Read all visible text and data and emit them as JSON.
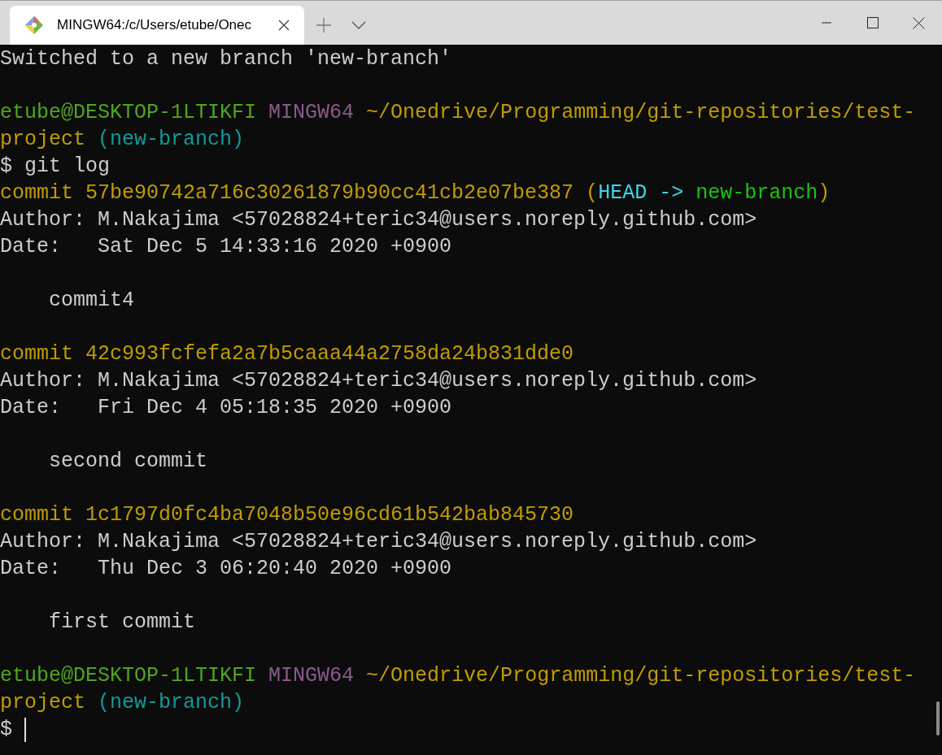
{
  "tab": {
    "title": "MINGW64:/c/Users/etube/Onec",
    "selected": true
  },
  "terminal": {
    "blocks": [
      [
        [
          {
            "text": "Switched to a new branch 'new-branch'",
            "kind": "plain"
          }
        ]
      ],
      [
        [
          {
            "text": "etube@DESKTOP-1LTIKFI ",
            "kind": "user"
          },
          {
            "text": "MINGW64 ",
            "kind": "system"
          },
          {
            "text": "~/Onedrive/Programming/git-repositories/test-",
            "kind": "path"
          }
        ],
        [
          {
            "text": "project ",
            "kind": "path"
          },
          {
            "text": "(new-branch)",
            "kind": "branch"
          }
        ],
        [
          {
            "text": "$ git log",
            "kind": "plain"
          }
        ],
        [
          {
            "text": "commit 57be90742a716c30261879b90cc41cb2e07be387 (",
            "kind": "hash"
          },
          {
            "text": "HEAD -> ",
            "kind": "head"
          },
          {
            "text": "new-branch",
            "kind": "ref"
          },
          {
            "text": ")",
            "kind": "hash"
          }
        ],
        [
          {
            "text": "Author: M.Nakajima <57028824+teric34@users.noreply.github.com>",
            "kind": "plain"
          }
        ],
        [
          {
            "text": "Date:   Sat Dec 5 14:33:16 2020 +0900",
            "kind": "plain"
          }
        ]
      ],
      [
        [
          {
            "text": "    commit4",
            "kind": "plain"
          }
        ]
      ],
      [
        [
          {
            "text": "commit 42c993fcfefa2a7b5caaa44a2758da24b831dde0",
            "kind": "hash"
          }
        ],
        [
          {
            "text": "Author: M.Nakajima <57028824+teric34@users.noreply.github.com>",
            "kind": "plain"
          }
        ],
        [
          {
            "text": "Date:   Fri Dec 4 05:18:35 2020 +0900",
            "kind": "plain"
          }
        ]
      ],
      [
        [
          {
            "text": "    second commit",
            "kind": "plain"
          }
        ]
      ],
      [
        [
          {
            "text": "commit 1c1797d0fc4ba7048b50e96cd61b542bab845730",
            "kind": "hash"
          }
        ],
        [
          {
            "text": "Author: M.Nakajima <57028824+teric34@users.noreply.github.com>",
            "kind": "plain"
          }
        ],
        [
          {
            "text": "Date:   Thu Dec 3 06:20:40 2020 +0900",
            "kind": "plain"
          }
        ]
      ],
      [
        [
          {
            "text": "    first commit",
            "kind": "plain"
          }
        ]
      ],
      [
        [
          {
            "text": "etube@DESKTOP-1LTIKFI ",
            "kind": "user"
          },
          {
            "text": "MINGW64 ",
            "kind": "system"
          },
          {
            "text": "~/Onedrive/Programming/git-repositories/test-",
            "kind": "path"
          }
        ],
        [
          {
            "text": "project ",
            "kind": "path"
          },
          {
            "text": "(new-branch)",
            "kind": "branch"
          }
        ],
        [
          {
            "text": "$",
            "kind": "plain"
          }
        ]
      ]
    ],
    "cursor": true
  }
}
